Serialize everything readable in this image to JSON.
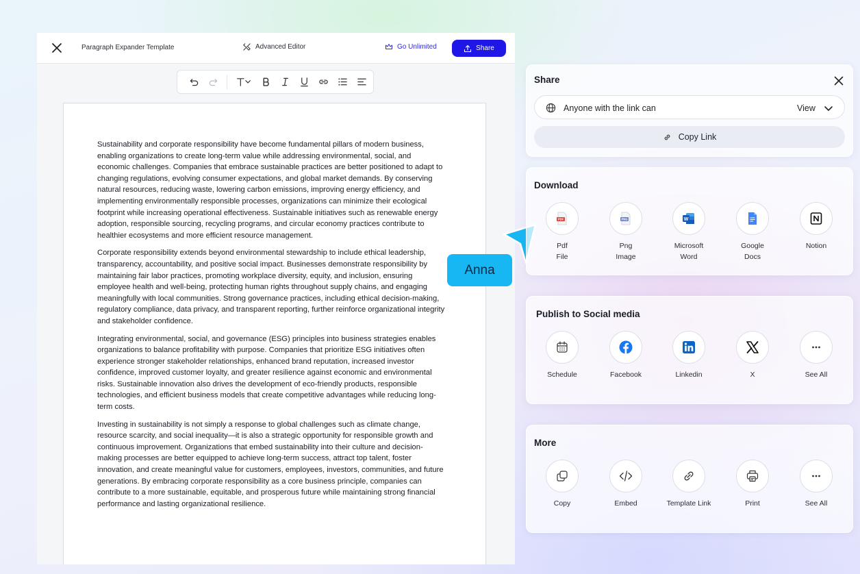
{
  "editor": {
    "title": "Paragraph Expander Template",
    "advanced_editor": "Advanced Editor",
    "go_unlimited": "Go Unlimited",
    "share": "Share"
  },
  "document": {
    "paragraphs": [
      "Sustainability and corporate responsibility have become fundamental pillars of modern business, enabling organizations to create long-term value while addressing environmental, social, and economic challenges. Companies that embrace sustainable practices are better positioned to adapt to changing regulations, evolving consumer expectations, and global market demands. By conserving natural resources, reducing waste, lowering carbon emissions, improving energy efficiency, and implementing environmentally responsible processes, organizations can minimize their ecological footprint while increasing operational effectiveness. Sustainable initiatives such as renewable energy adoption, responsible sourcing, recycling programs, and circular economy practices contribute to healthier ecosystems and more efficient resource management.",
      "Corporate responsibility extends beyond environmental stewardship to include ethical leadership, transparency, accountability, and positive social impact. Businesses demonstrate responsibility by maintaining fair labor practices, promoting workplace diversity, equity, and inclusion, ensuring employee health and well-being, protecting human rights throughout supply chains, and engaging meaningfully with local communities. Strong governance practices, including ethical decision-making, regulatory compliance, data privacy, and transparent reporting, further reinforce organizational integrity and stakeholder confidence.",
      "Integrating environmental, social, and governance (ESG) principles into business strategies enables organizations to balance profitability with purpose. Companies that prioritize ESG initiatives often experience stronger stakeholder relationships, enhanced brand reputation, increased investor confidence, improved customer loyalty, and greater resilience against economic and environmental risks. Sustainable innovation also drives the development of eco-friendly products, responsible technologies, and efficient business models that create competitive advantages while reducing long-term costs.",
      "Investing in sustainability is not simply a response to global challenges such as climate change, resource scarcity, and social inequality—it is also a strategic opportunity for responsible growth and continuous improvement. Organizations that embed sustainability into their culture and decision-making processes are better equipped to achieve long-term success, attract top talent, foster innovation, and create meaningful value for customers, employees, investors, communities, and future generations. By embracing corporate responsibility as a core business principle, companies can contribute to a more sustainable, equitable, and prosperous future while maintaining strong financial performance and lasting organizational resilience."
    ]
  },
  "collaborator": {
    "name": "Anna",
    "color": "#16b7f2"
  },
  "share_panel": {
    "title": "Share",
    "access_label": "Anyone with the link can",
    "permission": "View",
    "copy_link": "Copy Link"
  },
  "download": {
    "title": "Download",
    "items": [
      {
        "label": "Pdf\nFile",
        "icon": "pdf-icon"
      },
      {
        "label": "Png\nImage",
        "icon": "png-icon"
      },
      {
        "label": "Microsoft\nWord",
        "icon": "word-icon"
      },
      {
        "label": "Google\nDocs",
        "icon": "google-docs-icon"
      },
      {
        "label": "Notion",
        "icon": "notion-icon"
      }
    ]
  },
  "social": {
    "title": "Publish to Social media",
    "items": [
      {
        "label": "Schedule",
        "icon": "calendar-icon"
      },
      {
        "label": "Facebook",
        "icon": "facebook-icon"
      },
      {
        "label": "Linkedin",
        "icon": "linkedin-icon"
      },
      {
        "label": "X",
        "icon": "x-icon"
      },
      {
        "label": "See All",
        "icon": "more-icon"
      }
    ]
  },
  "more": {
    "title": "More",
    "items": [
      {
        "label": "Copy",
        "icon": "copy-icon"
      },
      {
        "label": "Embed",
        "icon": "code-icon"
      },
      {
        "label": "Template Link",
        "icon": "link-icon"
      },
      {
        "label": "Print",
        "icon": "printer-icon"
      },
      {
        "label": "See All",
        "icon": "more-icon"
      }
    ]
  },
  "colors": {
    "primary": "#1f17e8",
    "go_unlimited": "#2e2bd9",
    "facebook": "#1877f2",
    "linkedin": "#0a66c2",
    "word": "#185abd",
    "google_docs": "#4285f4",
    "pdf": "#e0443a"
  }
}
